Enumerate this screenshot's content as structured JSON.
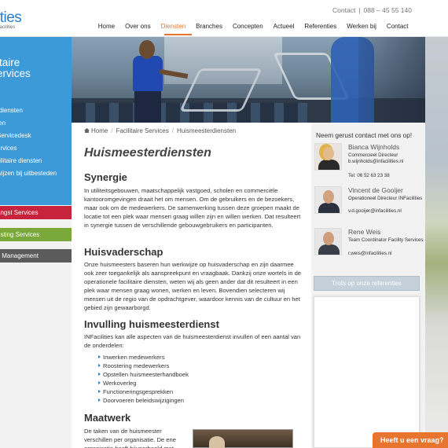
{
  "logo": {
    "main": "ities",
    "sub": "facilities"
  },
  "topbar": {
    "contact_label": "Contact",
    "separator": "|",
    "phone": "088 – 45 55 140"
  },
  "nav": [
    {
      "label": "Home"
    },
    {
      "label": "Over ons"
    },
    {
      "label": "Diensten"
    },
    {
      "label": "Branches"
    },
    {
      "label": "Concepten"
    },
    {
      "label": "Actueel"
    },
    {
      "label": "Referenties"
    },
    {
      "label": "Werken bij"
    },
    {
      "label": "Contact"
    }
  ],
  "sidebar": {
    "title_line1": "itaire",
    "title_line2": "ervices",
    "items": [
      {
        "label": "t"
      },
      {
        "label": "rdiensten"
      },
      {
        "label": "ten"
      },
      {
        "label": "Servicedesk"
      },
      {
        "label": "ervices"
      },
      {
        "label": "cilitaire diensten"
      },
      {
        "label": "wijzen bij uitbesteden"
      }
    ],
    "btn_red": "angst Services",
    "btn_green": "esting Services",
    "btn_gray": "y Management"
  },
  "breadcrumb": {
    "home": "Home",
    "sep": "/",
    "parent": "Facilitaire Services",
    "current": "Huismeesterdiensten"
  },
  "main": {
    "title": "Huismeesterdiensten",
    "sections": [
      {
        "title": "Synergie",
        "text": "In utiliteitsgebouwen, maatschappelijk vastgoed, scholen en commerciële kantooromgevingen draait het om mensen. Om de gebruikers en de bezoekers, maar ook om de medewerkers. De samenwerking tussen deze groepen maakt de locatie tot een plek waar mensen graag willen zijn en willen werken. Dat resulteert in synergie tussen de verschillende gebouwgebruikers en participanten."
      },
      {
        "title": "Huisvaderschap",
        "text": "Onze huismeesters baseren hun werkwijze op huisvaderschap en zijn daarmee ook zeer toegankelijk als aanspreekpunt en vraagbaak. Dankzij onze wortels in de operationele facilitaire diensten, weten wij als geen ander dat dit resulteert in een plek waar mensen graag wonen, werken en leven. Bovendien  selecteren wij mensen uit de regio van de opdrachtgever, waardoor kennis van de cultuur en het gebied zijn gewaarborgd."
      },
      {
        "title": "Invulling huismeesterdienst",
        "text": "INFacilities kan alle aspecten van de huismeesterdienst invullen of een aantal van de onderdelen:"
      },
      {
        "title": "Maatwerk",
        "text": "De taken van de huismeester verschillen per organisatie. De ene organisatie heeft bijvoorbeeld met"
      }
    ],
    "bullets": [
      "Inwerken medewerkers",
      "Roostering medewerkers",
      "Opstellen huismeesterhandboek",
      "Werkoverleg",
      "Functioneringsgesprekken",
      "Doorvoeren beleidswijzigingen"
    ]
  },
  "aside": {
    "title": "Neem gerust contact met ons op!",
    "people": [
      {
        "name": "Bianca Wijnholds",
        "role": "Commercieel Directeur",
        "email": "b.wijnholds@infacilities.nl",
        "phone": "Tel: 06 52 63 23 38"
      },
      {
        "name": "Vincent de Gooijer",
        "role": "Operationeel Directeur INFacilities",
        "email": "v.d.gooijer@infacilities.nl",
        "phone": ""
      },
      {
        "name": "Rene Weis",
        "role": "Team Coordinator Facility Services",
        "email": "r.weis@infacilities.nl",
        "phone": ""
      }
    ],
    "ref_button": "Trots op onze referenties"
  },
  "chat": {
    "label": "Heeft u een vraag?"
  },
  "colors": {
    "brand_blue": "#3d9ad9",
    "accent_orange": "#e8752f",
    "red": "#c8233c",
    "green": "#7aa83a",
    "gray": "#5b5b5b"
  }
}
